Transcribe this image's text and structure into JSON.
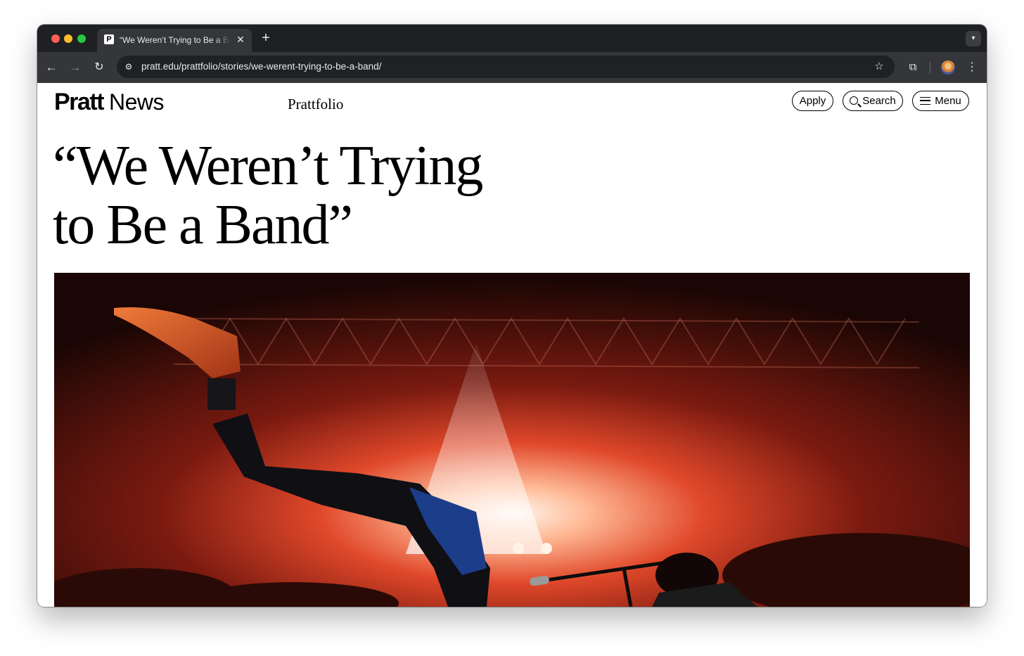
{
  "browser": {
    "tab": {
      "favicon": "P",
      "title": "“We Weren’t Trying to Be a Band”",
      "close_icon": "close-icon"
    },
    "new_tab_icon": "plus-icon",
    "tab_search_icon": "chevron-down-icon",
    "url": "pratt.edu/prattfolio/stories/we-werent-trying-to-be-a-band/",
    "icons": [
      "back-arrow-icon",
      "forward-arrow-icon",
      "reload-icon",
      "site-info-icon",
      "star-icon",
      "extensions-icon",
      "profile-avatar",
      "kebab-menu-icon"
    ]
  },
  "site": {
    "logo_bold": "Pratt",
    "logo_light": "News",
    "section": "Prattfolio",
    "buttons": {
      "apply": "Apply",
      "search": "Search",
      "menu": "Menu"
    }
  },
  "article": {
    "headline_line1": "“We Weren’t Trying",
    "headline_line2": "to Be a Band”"
  },
  "colors": {
    "browser_frame": "#1f2023",
    "toolbar": "#35363a",
    "omnibox": "#202124",
    "page_bg": "#ffffff",
    "text": "#000000"
  }
}
